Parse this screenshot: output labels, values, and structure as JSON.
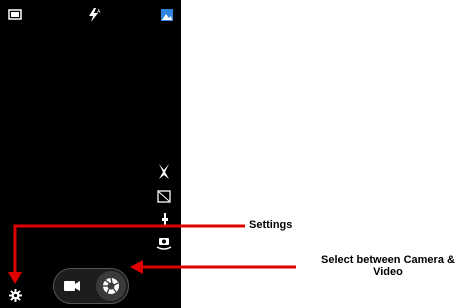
{
  "camera": {
    "top_icons": [
      "panorama-mode-icon",
      "flash-auto-icon",
      "gallery-thumbnail-icon"
    ],
    "right_icons": [
      "effects-icon",
      "scene-icon",
      "exposure-icon",
      "front-camera-switch-icon"
    ],
    "bottom": {
      "settings_icon": "gear-icon",
      "mode_switch": {
        "video_icon": "video-camera-icon",
        "camera_icon": "shutter-icon",
        "selected": "camera"
      }
    }
  },
  "annotations": {
    "settings_label": "Settings",
    "mode_label_line1": "Select between Camera &",
    "mode_label_line2": "Video"
  },
  "colors": {
    "screen_background": "#000000",
    "arrow": "#e00000",
    "gallery_icon": "#2e86de",
    "icons": "#ffffff"
  }
}
